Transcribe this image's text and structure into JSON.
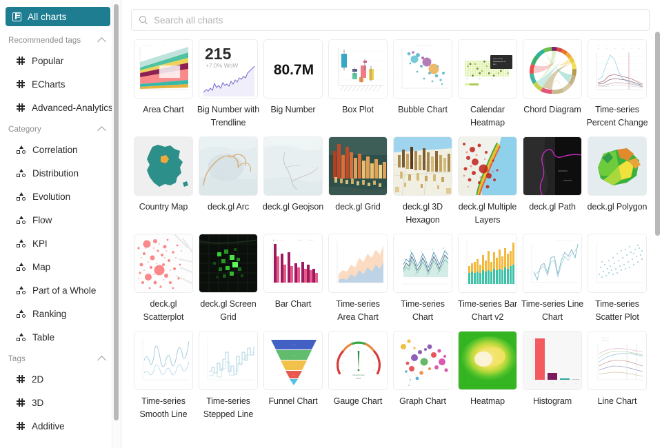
{
  "sidebar": {
    "all_charts": {
      "label": "All charts",
      "icon": "all-charts-icon",
      "active_color": "#1f7d92"
    },
    "sections": [
      {
        "title": "Recommended tags",
        "icon": "chevron-up-icon",
        "item_icon": "hash-icon",
        "items": [
          {
            "label": "Popular"
          },
          {
            "label": "ECharts"
          },
          {
            "label": "Advanced-Analytics"
          }
        ]
      },
      {
        "title": "Category",
        "icon": "chevron-up-icon",
        "item_icon": "category-icon",
        "items": [
          {
            "label": "Correlation"
          },
          {
            "label": "Distribution"
          },
          {
            "label": "Evolution"
          },
          {
            "label": "Flow"
          },
          {
            "label": "KPI"
          },
          {
            "label": "Map"
          },
          {
            "label": "Part of a Whole"
          },
          {
            "label": "Ranking"
          },
          {
            "label": "Table"
          }
        ]
      },
      {
        "title": "Tags",
        "icon": "chevron-up-icon",
        "item_icon": "hash-icon",
        "items": [
          {
            "label": "2D"
          },
          {
            "label": "3D"
          },
          {
            "label": "Additive"
          }
        ]
      }
    ]
  },
  "search": {
    "placeholder": "Search all charts",
    "value": "",
    "icon": "search-icon"
  },
  "gallery": {
    "charts": [
      {
        "label": "Area Chart",
        "thumb": "area-chart"
      },
      {
        "label": "Big Number with Trendline",
        "thumb": "big-number-trendline",
        "big_value": "215",
        "sub_value": "+7.0% WoW"
      },
      {
        "label": "Big Number",
        "thumb": "big-number",
        "big_value": "80.7M"
      },
      {
        "label": "Box Plot",
        "thumb": "box-plot"
      },
      {
        "label": "Bubble Chart",
        "thumb": "bubble-chart"
      },
      {
        "label": "Calendar Heatmap",
        "thumb": "calendar-heatmap"
      },
      {
        "label": "Chord Diagram",
        "thumb": "chord-diagram"
      },
      {
        "label": "Time-series Percent Change",
        "thumb": "ts-percent-change"
      },
      {
        "label": "Country Map",
        "thumb": "country-map"
      },
      {
        "label": "deck.gl Arc",
        "thumb": "deckgl-arc"
      },
      {
        "label": "deck.gl Geojson",
        "thumb": "deckgl-geojson"
      },
      {
        "label": "deck.gl Grid",
        "thumb": "deckgl-grid"
      },
      {
        "label": "deck.gl 3D Hexagon",
        "thumb": "deckgl-hexagon"
      },
      {
        "label": "deck.gl Multiple Layers",
        "thumb": "deckgl-multilayer"
      },
      {
        "label": "deck.gl Path",
        "thumb": "deckgl-path"
      },
      {
        "label": "deck.gl Polygon",
        "thumb": "deckgl-polygon"
      },
      {
        "label": "deck.gl Scatterplot",
        "thumb": "deckgl-scatterplot"
      },
      {
        "label": "deck.gl Screen Grid",
        "thumb": "deckgl-screengrid"
      },
      {
        "label": "Bar Chart",
        "thumb": "bar-chart"
      },
      {
        "label": "Time-series Area Chart",
        "thumb": "ts-area-chart"
      },
      {
        "label": "Time-series Chart",
        "thumb": "ts-chart"
      },
      {
        "label": "Time-series Bar Chart v2",
        "thumb": "ts-bar-chart-v2"
      },
      {
        "label": "Time-series Line Chart",
        "thumb": "ts-line-chart"
      },
      {
        "label": "Time-series Scatter Plot",
        "thumb": "ts-scatter-plot"
      },
      {
        "label": "Time-series Smooth Line",
        "thumb": "ts-smooth-line"
      },
      {
        "label": "Time-series Stepped Line",
        "thumb": "ts-stepped-line"
      },
      {
        "label": "Funnel Chart",
        "thumb": "funnel-chart"
      },
      {
        "label": "Gauge Chart",
        "thumb": "gauge-chart"
      },
      {
        "label": "Graph Chart",
        "thumb": "graph-chart"
      },
      {
        "label": "Heatmap",
        "thumb": "heatmap"
      },
      {
        "label": "Histogram",
        "thumb": "histogram"
      },
      {
        "label": "Line Chart",
        "thumb": "line-chart"
      }
    ]
  }
}
